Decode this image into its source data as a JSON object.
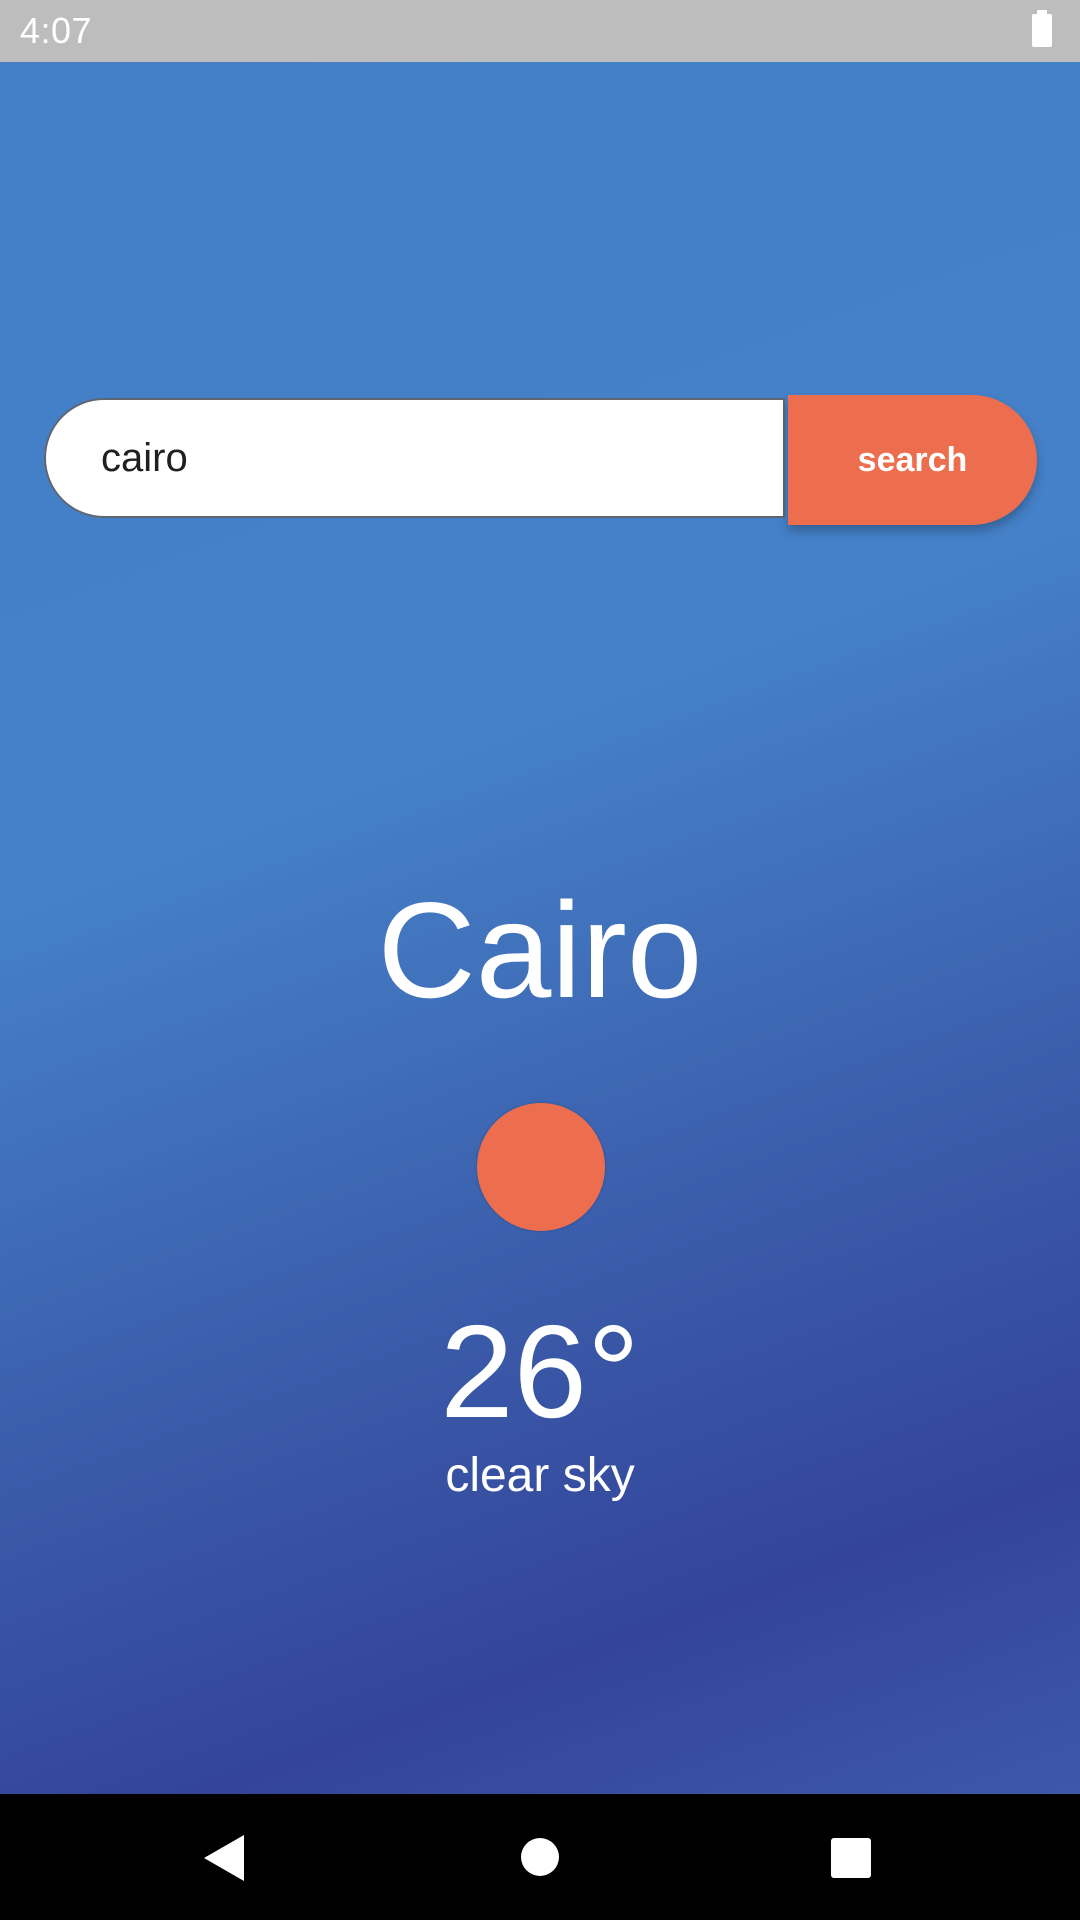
{
  "status_bar": {
    "time": "4:07",
    "battery_icon": "battery-full-icon"
  },
  "search": {
    "value": "cairo",
    "button_label": "search"
  },
  "weather": {
    "city": "Cairo",
    "icon": "weather-status-icon",
    "temperature": "26°",
    "description": "clear sky"
  },
  "nav_bar": {
    "back_icon": "back-triangle-icon",
    "home_icon": "home-circle-icon",
    "recents_icon": "recents-square-icon"
  },
  "colors": {
    "background_top": "#447fc6",
    "background_bottom": "#33449a",
    "accent": "#ec6e4e",
    "status_bar": "#bdbdbd",
    "nav_bar": "#000000"
  }
}
